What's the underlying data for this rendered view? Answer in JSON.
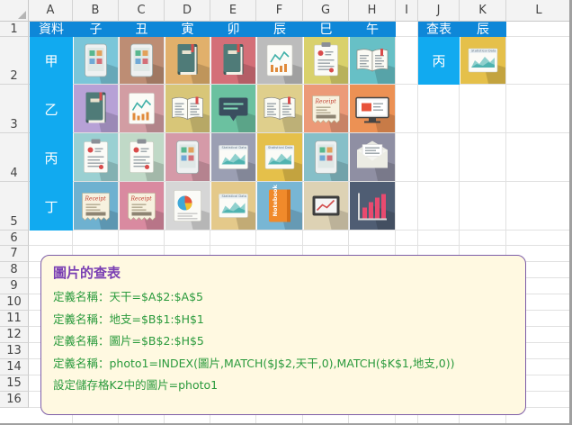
{
  "columns": [
    "A",
    "B",
    "C",
    "D",
    "E",
    "F",
    "G",
    "H",
    "I",
    "J",
    "K",
    "L"
  ],
  "rows": [
    "1",
    "2",
    "3",
    "4",
    "5",
    "6",
    "7",
    "8",
    "9",
    "10",
    "11",
    "12",
    "13",
    "14",
    "15",
    "16"
  ],
  "header_row": [
    "資料",
    "子",
    "丑",
    "寅",
    "卯",
    "辰",
    "巳",
    "午"
  ],
  "row_labels": [
    "甲",
    "乙",
    "丙",
    "丁"
  ],
  "lookup": {
    "header": "查表",
    "selected_branch": "辰",
    "selected_stem": "丙"
  },
  "icons": [
    [
      {
        "name": "tablet-icon",
        "bg": "#7ac6d9"
      },
      {
        "name": "tablet-icon",
        "bg": "#bd8d74"
      },
      {
        "name": "book-icon",
        "bg": "#e1b06b"
      },
      {
        "name": "book-icon",
        "bg": "#d46f78"
      },
      {
        "name": "chart-document-icon",
        "bg": "#bcbcbc"
      },
      {
        "name": "notepad-icon",
        "bg": "#d9d16c"
      },
      {
        "name": "open-book-icon",
        "bg": "#67c0c6"
      }
    ],
    [
      {
        "name": "book-icon",
        "bg": "#b7a1d6"
      },
      {
        "name": "chart-document-icon",
        "bg": "#d29da3"
      },
      {
        "name": "open-book-icon",
        "bg": "#d8c678"
      },
      {
        "name": "chat-icon",
        "bg": "#6bc1a0"
      },
      {
        "name": "open-book-icon",
        "bg": "#dfcf8c"
      },
      {
        "name": "receipt-icon",
        "bg": "#ec9a78"
      },
      {
        "name": "monitor-icon",
        "bg": "#ec9154"
      }
    ],
    [
      {
        "name": "notepad-icon",
        "bg": "#9ad0d2"
      },
      {
        "name": "notepad-icon",
        "bg": "#c0d9c7"
      },
      {
        "name": "tablet-icon",
        "bg": "#d59aa8"
      },
      {
        "name": "statistical-report-icon",
        "bg": "#9b9fb3"
      },
      {
        "name": "statistical-report-icon",
        "bg": "#e5c04a"
      },
      {
        "name": "tablet-icon",
        "bg": "#86bfc8"
      },
      {
        "name": "envelope-icon",
        "bg": "#8f8fa3"
      }
    ],
    [
      {
        "name": "receipt-icon",
        "bg": "#6eb1d0"
      },
      {
        "name": "receipt-icon",
        "bg": "#d98aa0"
      },
      {
        "name": "pie-chart-report-icon",
        "bg": "#d6d6d6"
      },
      {
        "name": "statistical-report-icon",
        "bg": "#e4c98a"
      },
      {
        "name": "notebook-icon",
        "bg": "#78b6d4"
      },
      {
        "name": "tablet-chart-icon",
        "bg": "#ddd2b4"
      },
      {
        "name": "bar-chart-icon",
        "bg": "#4f5d73"
      }
    ]
  ],
  "lookup_icon": {
    "name": "statistical-report-icon",
    "bg": "#e5c04a"
  },
  "note": {
    "title": "圖片的查表",
    "lines": [
      "定義名稱：天干=$A$2:$A$5",
      "定義名稱：地支=$B$1:$H$1",
      "定義名稱：圖片=$B$2:$H$5",
      "定義名稱：photo1=INDEX(圖片,MATCH($J$2,天干,0),MATCH($K$1,地支,0))",
      "設定儲存格K2中的圖片=photo1"
    ]
  },
  "colors": {
    "header_blue": "#0e87d8",
    "label_blue": "#11aaf0",
    "note_bg": "#fff9e1",
    "note_border": "#7e5ea8",
    "title_purple": "#7a3fb3",
    "text_green": "#2a9a3c"
  }
}
